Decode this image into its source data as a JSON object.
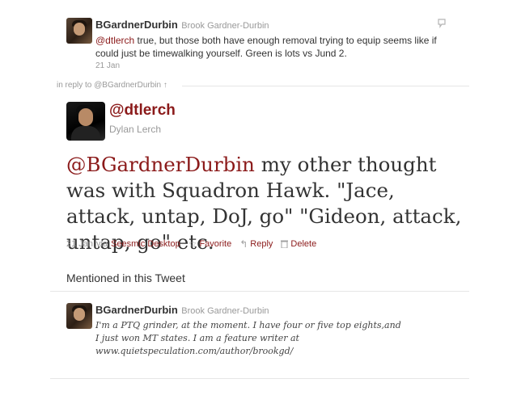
{
  "prior_tweet": {
    "username": "BGardnerDurbin",
    "realname": "Brook Gardner-Durbin",
    "mention": "@dtlerch",
    "text": " true, but those both have enough removal trying to equip seems like if could just be timewalking yourself. Green is lots vs Jund 2.",
    "timestamp": "21 Jan"
  },
  "reply_context": {
    "prefix": "in reply to ",
    "target": "@BGardnerDurbin",
    "arrow": "↑"
  },
  "main_tweet": {
    "screen_name": "@dtlerch",
    "realname": "Dylan Lerch",
    "mention": "@BGardnerDurbin",
    "text": " my other thought was with Squadron Hawk. \"Jace, attack, untap, DoJ, go\" \"Gideon, attack, untap, go\" etc.",
    "timestamp": "21 Jan",
    "via_label": "via",
    "source": "Seesmic Desktop",
    "actions": {
      "favorite": "Favorite",
      "reply": "Reply",
      "delete": "Delete"
    }
  },
  "mentioned": {
    "heading": "Mentioned in this Tweet",
    "user": {
      "username": "BGardnerDurbin",
      "realname": "Brook Gardner-Durbin",
      "bio": "I'm a PTQ grinder, at the moment. I have four or five top eights,and I just won MT states. I am a feature writer at www.quietspeculation.com/author/brookgd/"
    }
  },
  "colors": {
    "link": "#8b1a1a",
    "muted": "#999999",
    "text": "#333333"
  }
}
